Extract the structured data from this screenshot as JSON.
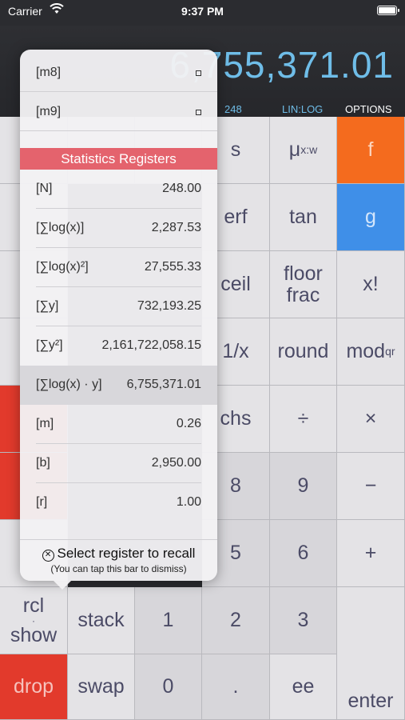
{
  "status_bar": {
    "carrier": "Carrier",
    "time": "9:37 PM"
  },
  "display": {
    "value": "6,755,371.01",
    "count": "248",
    "mode": "LIN:LOG",
    "options": "OPTIONS"
  },
  "keys": {
    "r1": [
      "",
      "",
      "",
      "s",
      "μ",
      "f"
    ],
    "mu_sub": "x:w",
    "r2": [
      "erf",
      "tan",
      "g"
    ],
    "r3": [
      "ceil",
      "floor",
      "frac",
      "x!"
    ],
    "r4": [
      "1/x",
      "round",
      "mod",
      "qr"
    ],
    "r5": [
      "chs",
      "÷",
      "×"
    ],
    "r6": [
      "8",
      "9",
      "−"
    ],
    "r7": [
      "5",
      "6",
      "+"
    ],
    "rcl": "rcl",
    "show": "show",
    "stack": "stack",
    "n1": "1",
    "n2": "2",
    "n3": "3",
    "enter": "enter",
    "drop": "drop",
    "swap": "swap",
    "n0": "0",
    "dot": ".",
    "ee": "ee"
  },
  "popup": {
    "memory": [
      {
        "label": "[m8]"
      },
      {
        "label": "[m9]"
      }
    ],
    "section_title": "Statistics Registers",
    "stats": [
      {
        "label": "[N]",
        "value": "248.00"
      },
      {
        "label": "[∑log(x)]",
        "value": "2,287.53"
      },
      {
        "label": "[∑log(x)²]",
        "value": "27,555.33"
      },
      {
        "label": "[∑y]",
        "value": "732,193.25"
      },
      {
        "label": "[∑y²]",
        "value": "2,161,722,058.15"
      },
      {
        "label": "[∑log(x) · y]",
        "value": "6,755,371.01"
      },
      {
        "label": "[m]",
        "value": "0.26"
      },
      {
        "label": "[b]",
        "value": "2,950.00"
      },
      {
        "label": "[r]",
        "value": "1.00"
      }
    ],
    "footer_main": "Select register to recall",
    "footer_hint": "(You can tap this bar to dismiss)"
  }
}
